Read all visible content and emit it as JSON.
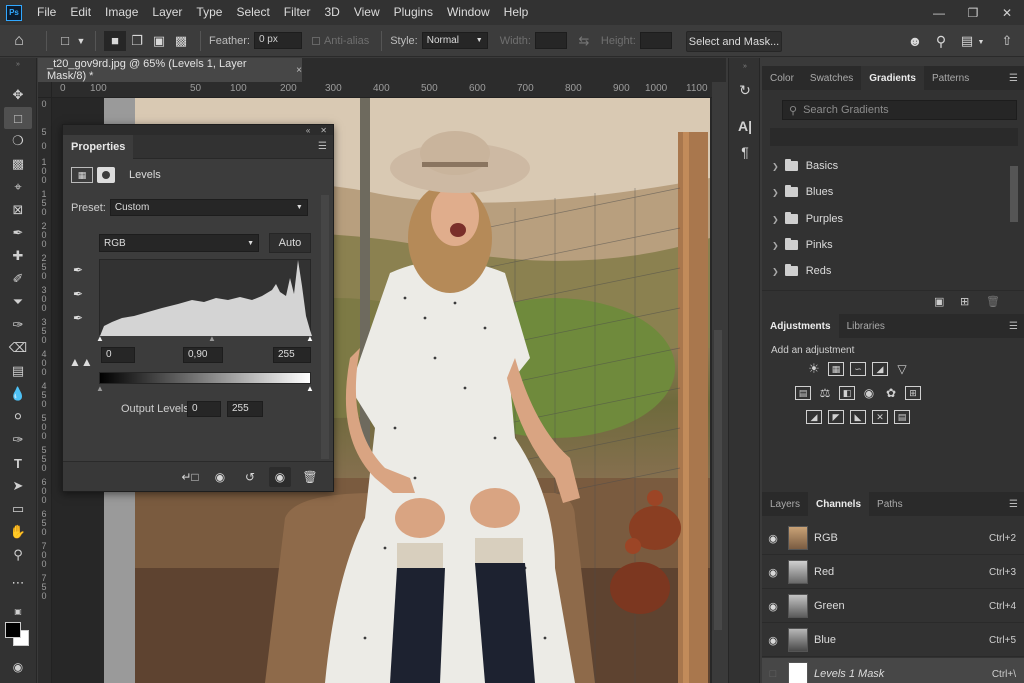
{
  "app": {
    "logo": "Ps"
  },
  "menu": [
    "File",
    "Edit",
    "Image",
    "Layer",
    "Type",
    "Select",
    "Filter",
    "3D",
    "View",
    "Plugins",
    "Window",
    "Help"
  ],
  "options": {
    "feather_label": "Feather:",
    "feather_value": "0 px",
    "antialias_label": "Anti-alias",
    "style_label": "Style:",
    "style_value": "Normal",
    "width_label": "Width:",
    "height_label": "Height:",
    "select_mask_label": "Select and Mask..."
  },
  "document": {
    "tab_title": "_t20_gov9rd.jpg @ 65% (Levels 1, Layer Mask/8) *",
    "close": "×"
  },
  "ruler": {
    "h_labels": [
      "0",
      "100",
      "50",
      "100",
      "200",
      "300",
      "400",
      "500",
      "600",
      "700",
      "800",
      "900",
      "1000",
      "1100"
    ],
    "v_labels": [
      "0",
      "5",
      "0",
      "1 0 0",
      "1 5 0",
      "2 0 0",
      "2 5 0",
      "3 0 0",
      "3 5 0",
      "4 0 0",
      "4 5 0",
      "5 0 0",
      "5 5 0",
      "6 0 0",
      "6 5 0",
      "7 0 0",
      "7 5 0"
    ]
  },
  "properties": {
    "title": "Properties",
    "subtitle": "Levels",
    "preset_label": "Preset:",
    "preset_value": "Custom",
    "channel_value": "RGB",
    "auto_label": "Auto",
    "input_black": "0",
    "input_gamma": "0,90",
    "input_white": "255",
    "output_label": "Output Levels:",
    "output_black": "0",
    "output_white": "255"
  },
  "gradients_panel": {
    "tabs": [
      "Color",
      "Swatches",
      "Gradients",
      "Patterns"
    ],
    "active_tab": "Gradients",
    "search_placeholder": "Search Gradients",
    "folders": [
      "Basics",
      "Blues",
      "Purples",
      "Pinks",
      "Reds"
    ]
  },
  "adjustments_panel": {
    "tabs": [
      "Adjustments",
      "Libraries"
    ],
    "active_tab": "Adjustments",
    "add_label": "Add an adjustment"
  },
  "channels_panel": {
    "tabs": [
      "Layers",
      "Channels",
      "Paths"
    ],
    "active_tab": "Channels",
    "channels": [
      {
        "name": "RGB",
        "shortcut": "Ctrl+2"
      },
      {
        "name": "Red",
        "shortcut": "Ctrl+3"
      },
      {
        "name": "Green",
        "shortcut": "Ctrl+4"
      },
      {
        "name": "Blue",
        "shortcut": "Ctrl+5"
      },
      {
        "name": "Levels 1 Mask",
        "shortcut": "Ctrl+\\"
      }
    ]
  },
  "colors": {
    "app_bg": "#3a3a3a",
    "panel_bg": "#323232",
    "accent_ps": "#31a8ff"
  }
}
